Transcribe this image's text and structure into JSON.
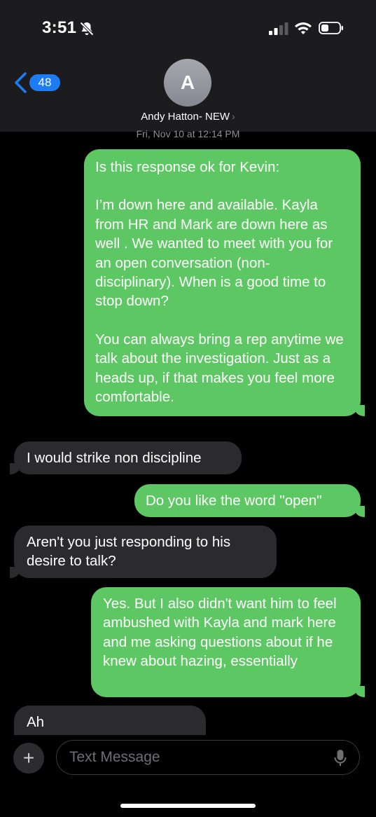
{
  "status_bar": {
    "time": "3:51"
  },
  "header": {
    "back_badge": "48",
    "avatar_initial": "A",
    "contact_name": "Andy Hatton- NEW",
    "chevron": "›"
  },
  "timestamp": "Fri, Nov 10 at 12:14 PM",
  "messages": [
    {
      "direction": "sent",
      "paragraphs": [
        "Is this response ok for Kevin:",
        "I’m down here and available. Kayla from HR and Mark are down here as well . We wanted to meet with you for an open conversation (non-disciplinary). When is a good time to stop down?",
        "You can always bring a rep anytime we talk about the investigation. Just as a heads up, if that makes you feel more comfortable."
      ]
    },
    {
      "direction": "received",
      "text": "I would strike non discipline"
    },
    {
      "direction": "sent",
      "text": "Do you like the word \"open\""
    },
    {
      "direction": "received",
      "text": "Aren't you just responding to his desire to talk?"
    },
    {
      "direction": "sent",
      "text": "Yes. But I also didn't want him to feel ambushed with Kayla and mark here and me asking questions about if he knew about hazing, essentially"
    },
    {
      "direction": "received",
      "text": "Ah"
    }
  ],
  "input": {
    "placeholder": "Text Message",
    "plus_label": "+"
  },
  "colors": {
    "sent_bubble": "#5dc863",
    "received_bubble": "#2b2b2d",
    "accent": "#1e7cf2"
  },
  "icons": [
    "bell-slash-icon",
    "signal-icon",
    "wifi-icon",
    "battery-icon",
    "back-chevron-icon",
    "plus-icon",
    "microphone-icon"
  ]
}
